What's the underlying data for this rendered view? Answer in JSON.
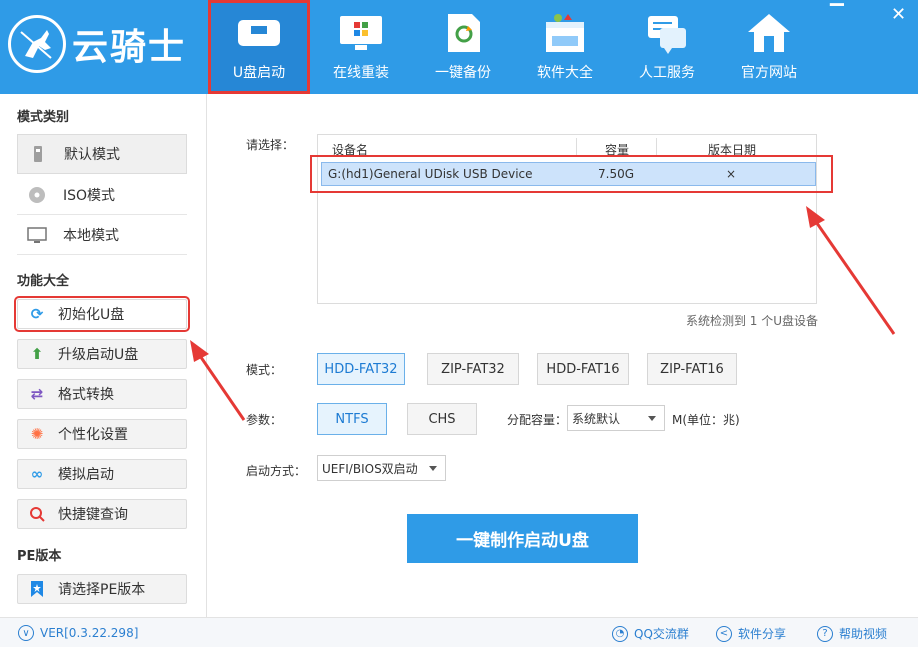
{
  "app": {
    "name": "云骑士"
  },
  "window": {
    "minimize": "▔",
    "close": "✕"
  },
  "nav": [
    {
      "label": "U盘启动",
      "icon": "usb-drive-icon"
    },
    {
      "label": "在线重装",
      "icon": "monitor-windows-icon"
    },
    {
      "label": "一键备份",
      "icon": "backup-icon"
    },
    {
      "label": "软件大全",
      "icon": "software-box-icon"
    },
    {
      "label": "人工服务",
      "icon": "chat-service-icon"
    },
    {
      "label": "官方网站",
      "icon": "home-icon"
    }
  ],
  "sidebar": {
    "mode_title": "模式类别",
    "modes": [
      {
        "label": "默认模式",
        "icon": "usb-stick-icon"
      },
      {
        "label": "ISO模式",
        "icon": "disc-icon"
      },
      {
        "label": "本地模式",
        "icon": "monitor-icon"
      }
    ],
    "func_title": "功能大全",
    "functions": [
      {
        "label": "初始化U盘",
        "icon": "refresh-icon"
      },
      {
        "label": "升级启动U盘",
        "icon": "up-arrow-icon"
      },
      {
        "label": "格式转换",
        "icon": "swap-icon"
      },
      {
        "label": "个性化设置",
        "icon": "gear-icon"
      },
      {
        "label": "模拟启动",
        "icon": "link-icon"
      },
      {
        "label": "快捷键查询",
        "icon": "search-icon"
      }
    ],
    "pe_title": "PE版本",
    "pe_button": {
      "label": "请选择PE版本",
      "icon": "bookmark-icon"
    }
  },
  "main": {
    "select_label": "请选择：",
    "table": {
      "headers": [
        "设备名",
        "容量",
        "版本日期"
      ],
      "rows": [
        {
          "name": "G:(hd1)General UDisk USB Device",
          "capacity": "7.50G",
          "date": "×"
        }
      ]
    },
    "detect_text": "系统检测到 1 个U盘设备",
    "mode_label": "模式：",
    "modes": [
      "HDD-FAT32",
      "ZIP-FAT32",
      "HDD-FAT16",
      "ZIP-FAT16"
    ],
    "selected_mode": "HDD-FAT32",
    "param_label": "参数：",
    "params": [
      "NTFS",
      "CHS"
    ],
    "alloc_label": "分配容量：",
    "alloc_value": "系统默认",
    "alloc_unit": "M(单位：兆)",
    "boot_label": "启动方式：",
    "boot_value": "UEFI/BIOS双启动",
    "make_button": "一键制作启动U盘"
  },
  "status": {
    "version": "VER[0.3.22.298]",
    "qq": "QQ交流群",
    "share": "软件分享",
    "help": "帮助视频"
  },
  "colors": {
    "brand": "#2f9be7",
    "highlight": "#e53935"
  }
}
